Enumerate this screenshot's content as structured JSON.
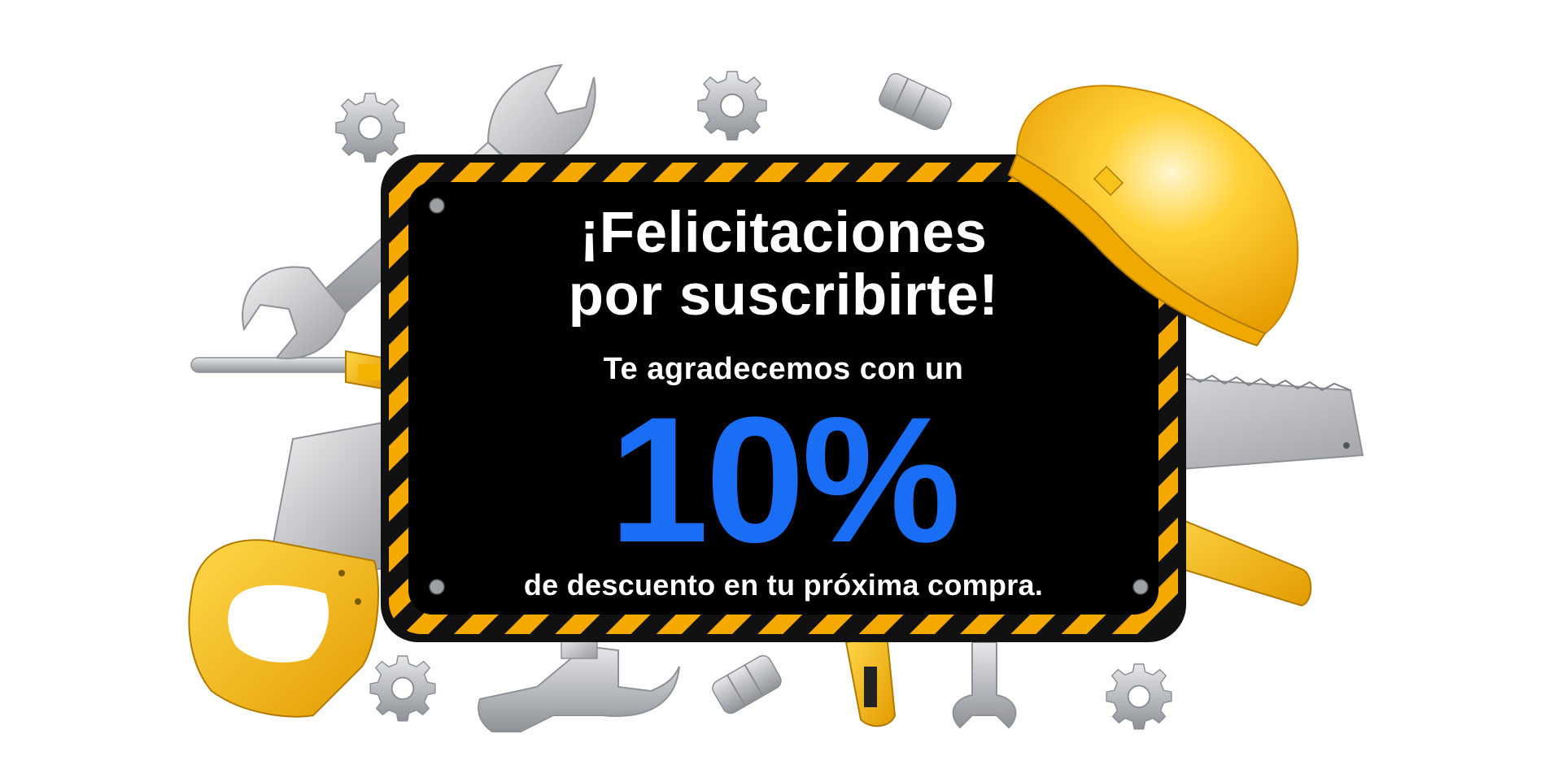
{
  "banner": {
    "headline_line1": "¡Felicitaciones",
    "headline_line2": "por suscribirte!",
    "thanks_line": "Te agradecemos con un",
    "discount": "10%",
    "discount_detail": "de descuento en tu próxima compra."
  },
  "illustrations": {
    "icons": [
      "hard-hat-icon",
      "wrench-icon",
      "screwdriver-icon",
      "hand-saw-icon",
      "hammer-icon",
      "gear-icon",
      "bolt-nut-icon"
    ]
  },
  "colors": {
    "background": "#ffffff",
    "sign_face": "#000000",
    "hazard_yellow": "#f5a800",
    "hazard_black": "#111111",
    "headline_text": "#ffffff",
    "discount_blue": "#1a6ef5",
    "hard_hat_yellow": "#f7b500",
    "tool_handle_yellow": "#f3b400",
    "tool_metal": "#b9bcc0"
  }
}
